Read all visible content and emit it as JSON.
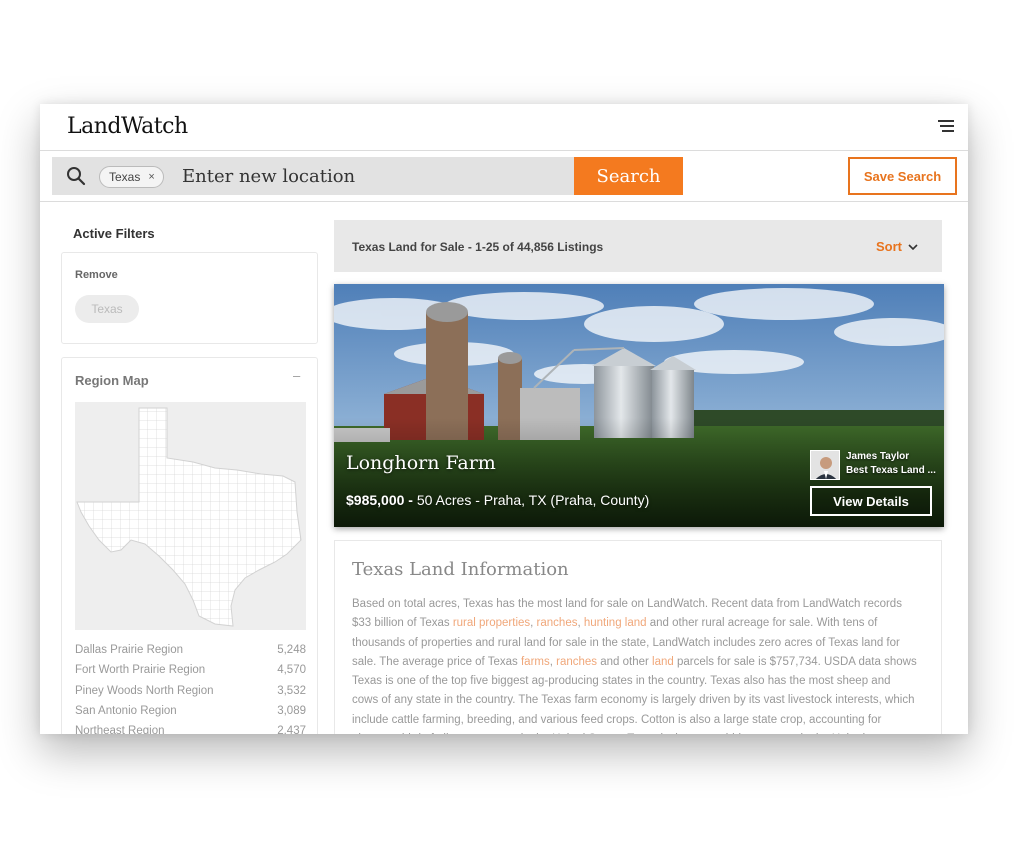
{
  "header": {
    "logo": "LandWatch"
  },
  "search": {
    "chip_label": "Texas",
    "chip_remove": "×",
    "placeholder": "Enter new location",
    "button_label": "Search",
    "save_label": "Save Search"
  },
  "sidebar": {
    "active_filters_title": "Active Filters",
    "remove_label": "Remove",
    "remove_chip": "Texas",
    "region_map_title": "Region Map",
    "collapse_symbol": "–",
    "regions": [
      {
        "name": "Dallas Prairie Region",
        "count": "5,248"
      },
      {
        "name": "Fort Worth Prairie Region",
        "count": "4,570"
      },
      {
        "name": "Piney Woods North Region",
        "count": "3,532"
      },
      {
        "name": "San Antonio Region",
        "count": "3,089"
      },
      {
        "name": "Northeast Region",
        "count": "2,437"
      }
    ]
  },
  "results": {
    "title": "Texas Land for Sale - 1-25 of 44,856 Listings",
    "sort_label": "Sort"
  },
  "listing": {
    "name": "Longhorn Farm",
    "price": "$985,000 -",
    "details": " 50 Acres - Praha, TX (Praha, County)",
    "agent_name": "James Taylor",
    "agent_company": "Best Texas Land ...",
    "view_label": "View Details"
  },
  "info": {
    "title": "Texas Land Information",
    "p1": "Based on total acres, Texas has the most land for sale on LandWatch. Recent data from LandWatch records $33 billion of Texas ",
    "link1": "rural properties",
    "sep1": ", ",
    "link2": "ranches",
    "sep2": ", ",
    "link3": "hunting land",
    "p2": " and other rural acreage for sale. With tens of thousands of properties and rural land for sale in the state, LandWatch includes zero acres of Texas land for sale. The average price of Texas ",
    "link4": "farms",
    "sep3": ", ",
    "link5": "ranches",
    "p3": " and other ",
    "link6": "land",
    "p4": " parcels for sale is $757,734. USDA data shows Texas is one of the top five biggest ag-producing states in the country. Texas also has the most sheep and cows of any state in the country. The Texas farm economy is largely driven by its vast livestock interests, which include cattle farming, breeding, and various feed crops. Cotton is also a large state crop, accounting for almost a third of all cotton grown in the United States. Texas is the second-biggest state in the United"
  },
  "colors": {
    "accent": "#f47a1f",
    "link": "#f0a77a"
  }
}
